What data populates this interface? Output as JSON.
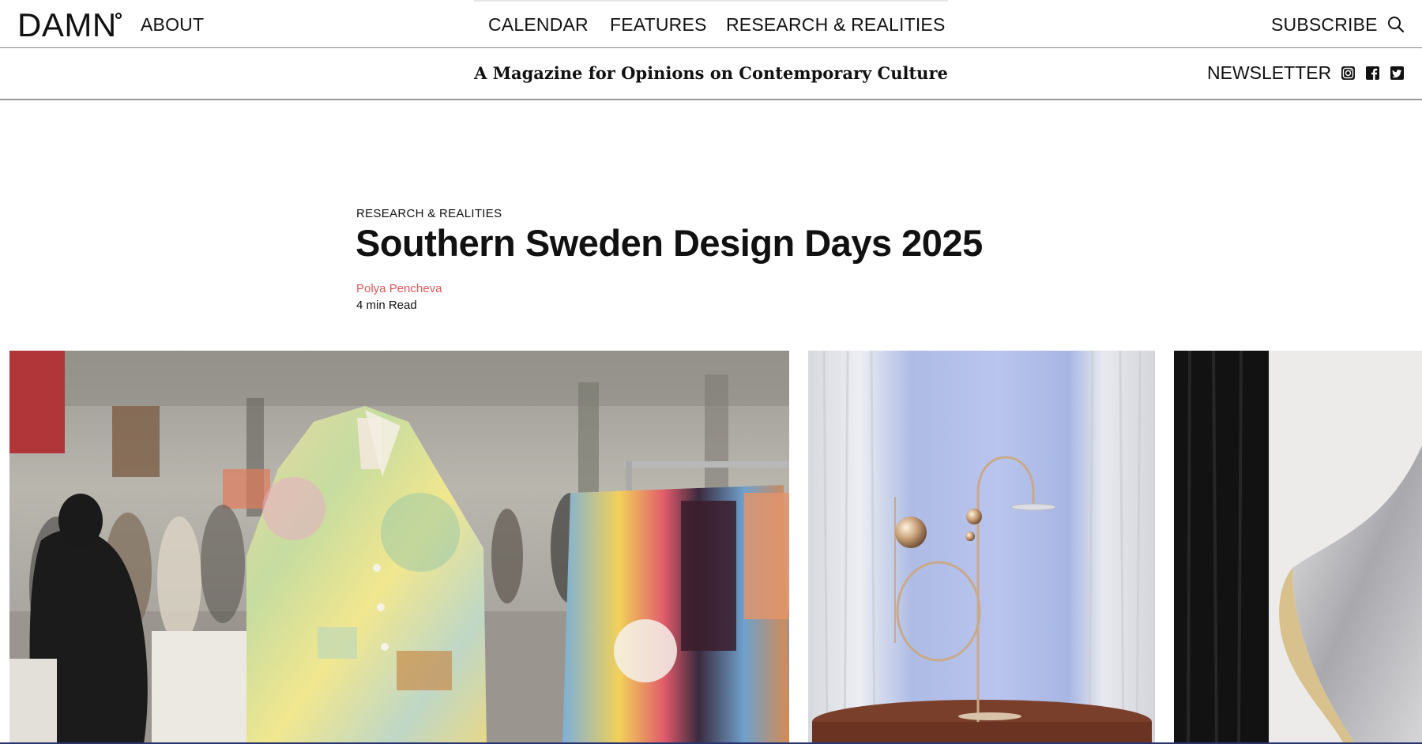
{
  "header": {
    "logo": "DAMN",
    "nav_left": "ABOUT",
    "nav_center": [
      "CALENDAR",
      "FEATURES",
      "RESEARCH & REALITIES"
    ],
    "subscribe": "SUBSCRIBE",
    "search_icon": "search-icon"
  },
  "subheader": {
    "tagline": "A Magazine for Opinions on Contemporary Culture",
    "newsletter": "NEWSLETTER",
    "social_icons": [
      "instagram-icon",
      "facebook-icon",
      "twitter-icon"
    ]
  },
  "article": {
    "category": "RESEARCH & REALITIES",
    "title": "Southern Sweden Design Days 2025",
    "author": "Polya Pencheva",
    "read_time": "4 min Read"
  },
  "colors": {
    "author_link": "#e0575b",
    "text": "#111111"
  }
}
